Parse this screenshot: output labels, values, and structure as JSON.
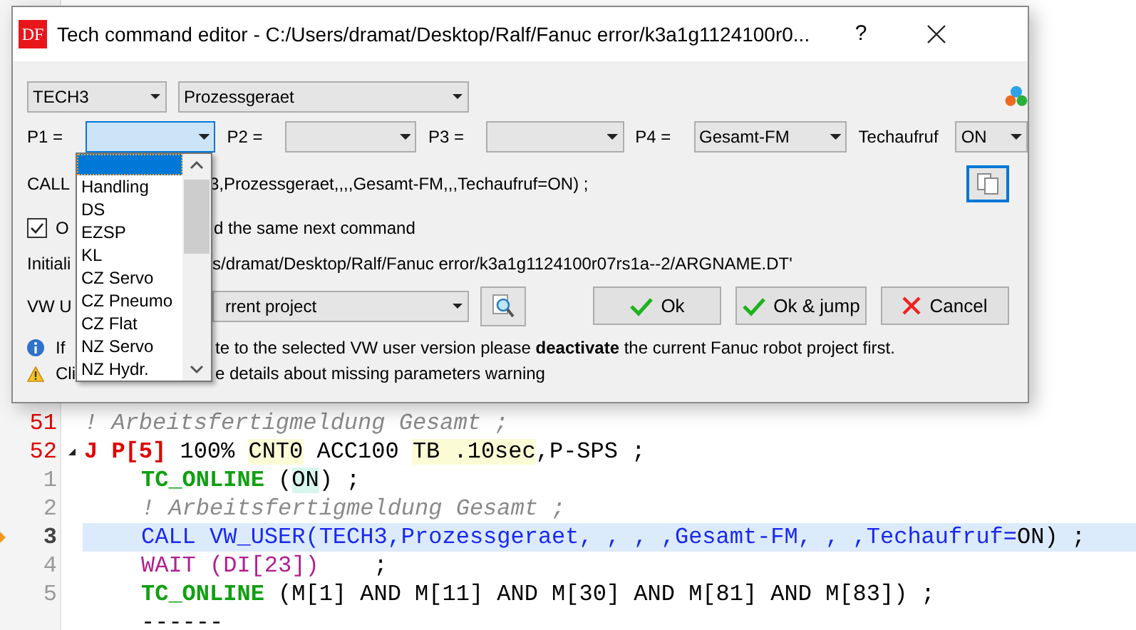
{
  "editor": {
    "lines": [
      {
        "number": "51",
        "selected": false,
        "tokens": [
          {
            "text": "! Arbeitsfertigmeldung Gesamt ;",
            "kind": "comment"
          }
        ]
      },
      {
        "number": "52",
        "selected": false,
        "expanded": true,
        "tokens": [
          {
            "text": "J P[5]",
            "kind": "motion"
          },
          {
            "text": " 100% ",
            "kind": "plain"
          },
          {
            "text": "CNT0",
            "kind": "option"
          },
          {
            "text": " ACC100 ",
            "kind": "plain"
          },
          {
            "text": "TB .10sec",
            "kind": "option"
          },
          {
            "text": ",P-SPS ;",
            "kind": "plain"
          }
        ],
        "children": [
          {
            "number": "1",
            "selected": false,
            "tokens": [
              {
                "text": "TC_ONLINE",
                "kind": "instruction"
              },
              {
                "text": " (",
                "kind": "plain"
              },
              {
                "text": "ON",
                "kind": "value"
              },
              {
                "text": ") ;",
                "kind": "plain"
              }
            ]
          },
          {
            "number": "2",
            "selected": false,
            "tokens": [
              {
                "text": "! Arbeitsfertigmeldung Gesamt ;",
                "kind": "comment"
              }
            ]
          },
          {
            "number": "3",
            "selected": true,
            "tokens": [
              {
                "text": "CALL VW_USER(TECH3,Prozessgeraet, , , ,Gesamt-FM, , ,Techaufruf=",
                "kind": "call"
              },
              {
                "text": "ON) ;",
                "kind": "plain"
              }
            ]
          },
          {
            "number": "4",
            "selected": false,
            "tokens": [
              {
                "text": "WAIT (DI[23])",
                "kind": "wait"
              },
              {
                "text": "    ;",
                "kind": "plain"
              }
            ]
          },
          {
            "number": "5",
            "selected": false,
            "tokens": [
              {
                "text": "TC_ONLINE",
                "kind": "instruction"
              },
              {
                "text": " (M[1] AND M[11] AND M[30] AND M[81] AND M[83]) ;",
                "kind": "plain"
              }
            ]
          },
          {
            "selected": false,
            "tokens": [
              {
                "text": "------",
                "kind": "plain"
              }
            ]
          }
        ]
      }
    ]
  },
  "dialog": {
    "logo_text": "DF",
    "title": "Tech command editor - C:/Users/dramat/Desktop/Ralf/Fanuc error/k3a1g1124100r0...",
    "help_button": "?",
    "tech_select": {
      "value": "TECH3"
    },
    "device_select": {
      "value": "Prozessgeraet"
    },
    "params": [
      {
        "label": "P1 =",
        "focused": true
      },
      {
        "label": "P2 =",
        "focused": false
      },
      {
        "label": "P3 =",
        "focused": false
      },
      {
        "label": "P4 =",
        "value": "Gesamt-FM",
        "focused": false
      }
    ],
    "techaufruf": {
      "label": "Techaufruf",
      "value": "ON"
    },
    "command_preview": [
      "CALL",
      "3,Prozessgeraet,,,,Gesamt-FM,,,Techaufruf=ON) ;"
    ],
    "checkbox": {
      "label": [
        "O",
        "d the same next command"
      ],
      "checked": true
    },
    "init_text": [
      "Initiali",
      "s/dramat/Desktop/Ralf/Fanuc error/k3a1g1124100r07rs1a--2/ARGNAME.DT'"
    ],
    "version": {
      "label": "VW U",
      "value": "rrent project"
    },
    "buttons": [
      {
        "label": "Ok",
        "kind": "ok"
      },
      {
        "label": "Ok & jump",
        "kind": "ok"
      },
      {
        "label": "Cancel",
        "kind": "cancel"
      }
    ],
    "info": [
      "If",
      "te to the selected VW user version please **deactivate** the current Fanuc robot project first."
    ],
    "warning": [
      "Cli",
      "e details about missing parameters warning"
    ],
    "dropdown": {
      "items": [
        {
          "selected": true
        },
        {
          "label": "Handling",
          "selected": false
        },
        {
          "label": "DS",
          "selected": false
        },
        {
          "label": "EZSP",
          "selected": false
        },
        {
          "label": "KL",
          "selected": false
        },
        {
          "label": "CZ Servo",
          "selected": false
        },
        {
          "label": "CZ Pneumo",
          "selected": false
        },
        {
          "label": "CZ Flat",
          "selected": false
        },
        {
          "label": "NZ Servo",
          "selected": false
        },
        {
          "label": "NZ Hydr.",
          "selected": false
        }
      ]
    }
  }
}
